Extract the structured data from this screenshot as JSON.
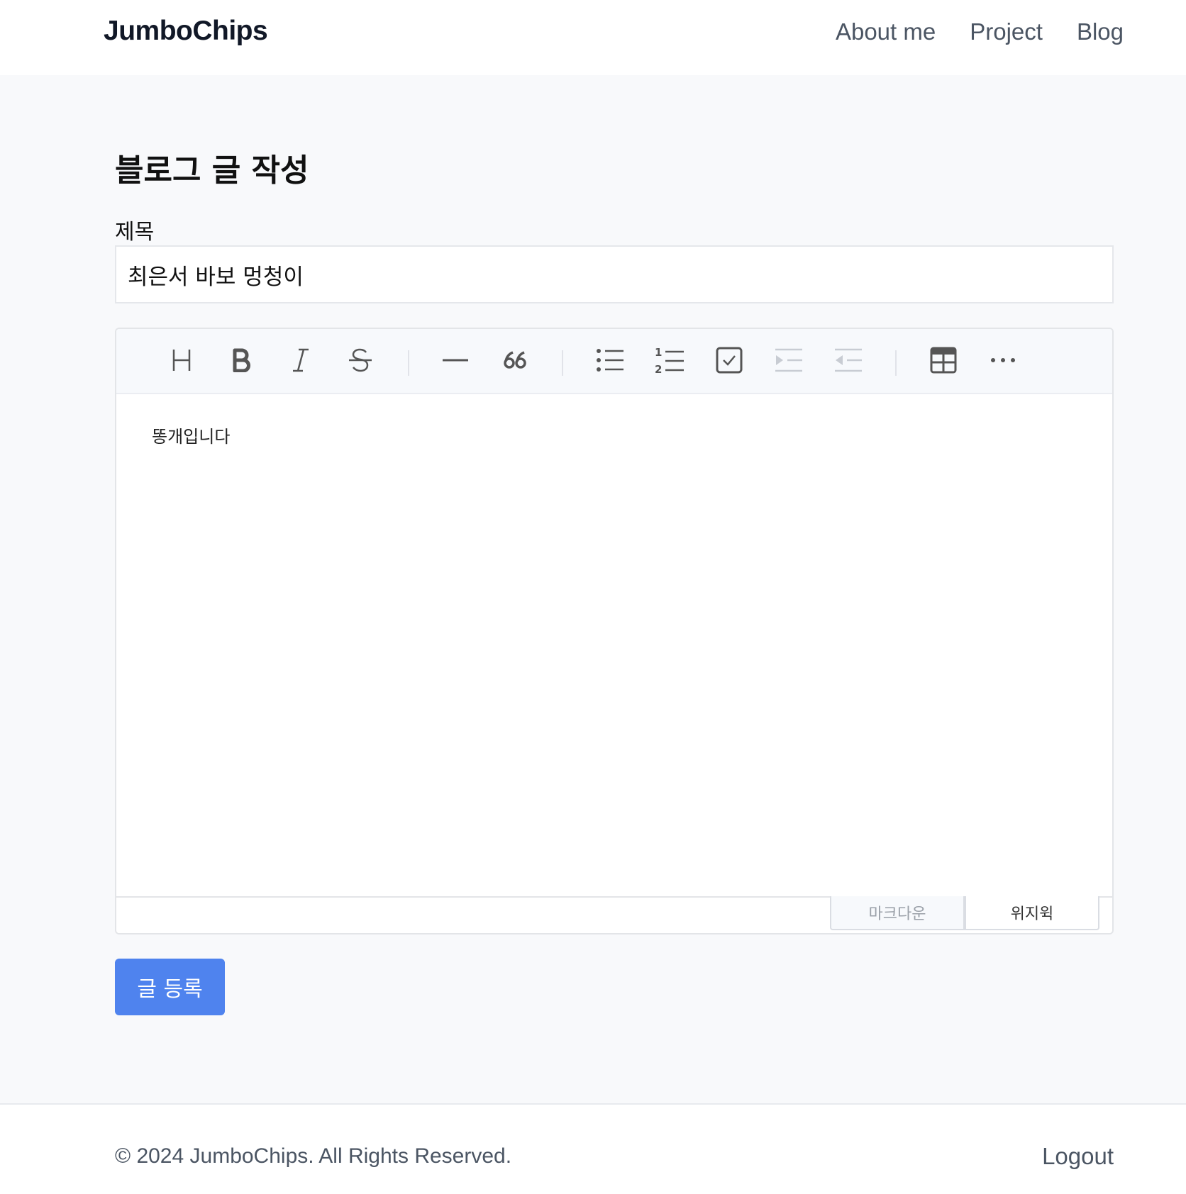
{
  "header": {
    "brand": "JumboChips",
    "nav": [
      "About me",
      "Project",
      "Blog"
    ]
  },
  "main": {
    "page_title": "블로그 글 작성",
    "title_label": "제목",
    "title_value": "최은서 바보 멍청이",
    "editor": {
      "toolbar_icons": [
        "heading-icon",
        "bold-icon",
        "italic-icon",
        "strike-icon",
        "hr-icon",
        "quote-icon",
        "bullet-list-icon",
        "ordered-list-icon",
        "task-list-icon",
        "indent-icon",
        "outdent-icon",
        "table-icon",
        "more-icon"
      ],
      "content": "똥개입니다",
      "modes": [
        "마크다운",
        "위지윅"
      ],
      "active_mode": "위지윅"
    },
    "submit_label": "글 등록"
  },
  "footer": {
    "copyright": "© 2024 JumboChips. All Rights Reserved.",
    "logout": "Logout"
  },
  "colors": {
    "accent": "#4f83ee",
    "background": "#f8f9fb"
  }
}
